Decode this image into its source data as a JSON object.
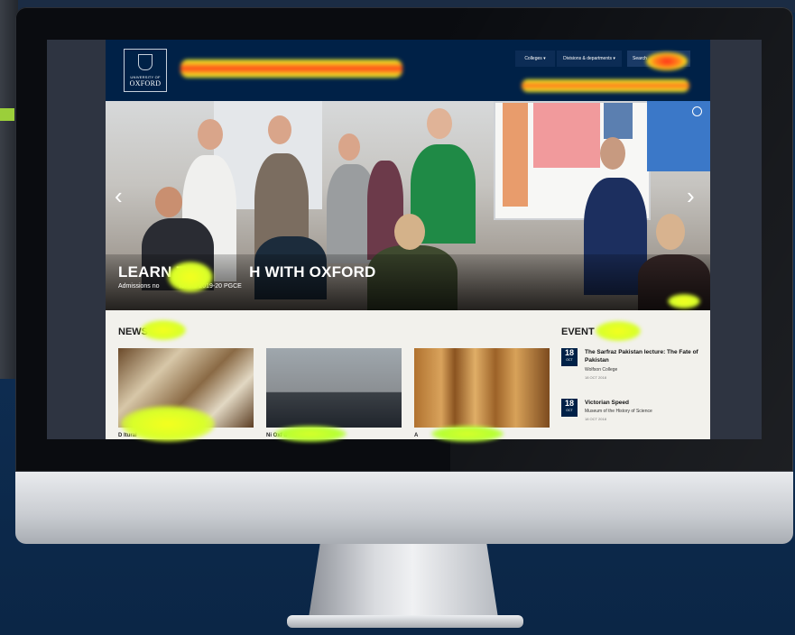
{
  "header": {
    "logo_university": "UNIVERSITY OF",
    "logo_oxford": "OXFORD",
    "nav": [
      "Colleges ▾",
      "Divisions & departments ▾",
      "Search"
    ]
  },
  "hero": {
    "title": "LEARN T",
    "title_rest": "H WITH OXFORD",
    "subtitle": "Admissions no",
    "subtitle_rest": "for the 2019-20 PGCE",
    "prev_arrow": "‹",
    "next_arrow": "›"
  },
  "news": {
    "heading": "NEWS",
    "items": [
      {
        "caption": "D                    ltural"
      },
      {
        "caption": "Ni                        Oxf d"
      },
      {
        "caption": "A                    "
      }
    ]
  },
  "events": {
    "heading": "EVENT",
    "items": [
      {
        "day": "18",
        "month": "OCT",
        "title": "The Sarfraz Pakistan lecture: The Fate of Pakistan",
        "venue": "Wolfson College",
        "date": "18 OCT 2018"
      },
      {
        "day": "18",
        "month": "OCT",
        "title": "Victorian Speed",
        "venue": "Museum of the History of Science",
        "date": "18 OCT 2018"
      }
    ]
  },
  "colors": {
    "oxford_blue": "#002147",
    "heat_red": "#ff2a1a",
    "heat_yellow": "#f5ff1e",
    "heat_green": "#b6ff32"
  }
}
